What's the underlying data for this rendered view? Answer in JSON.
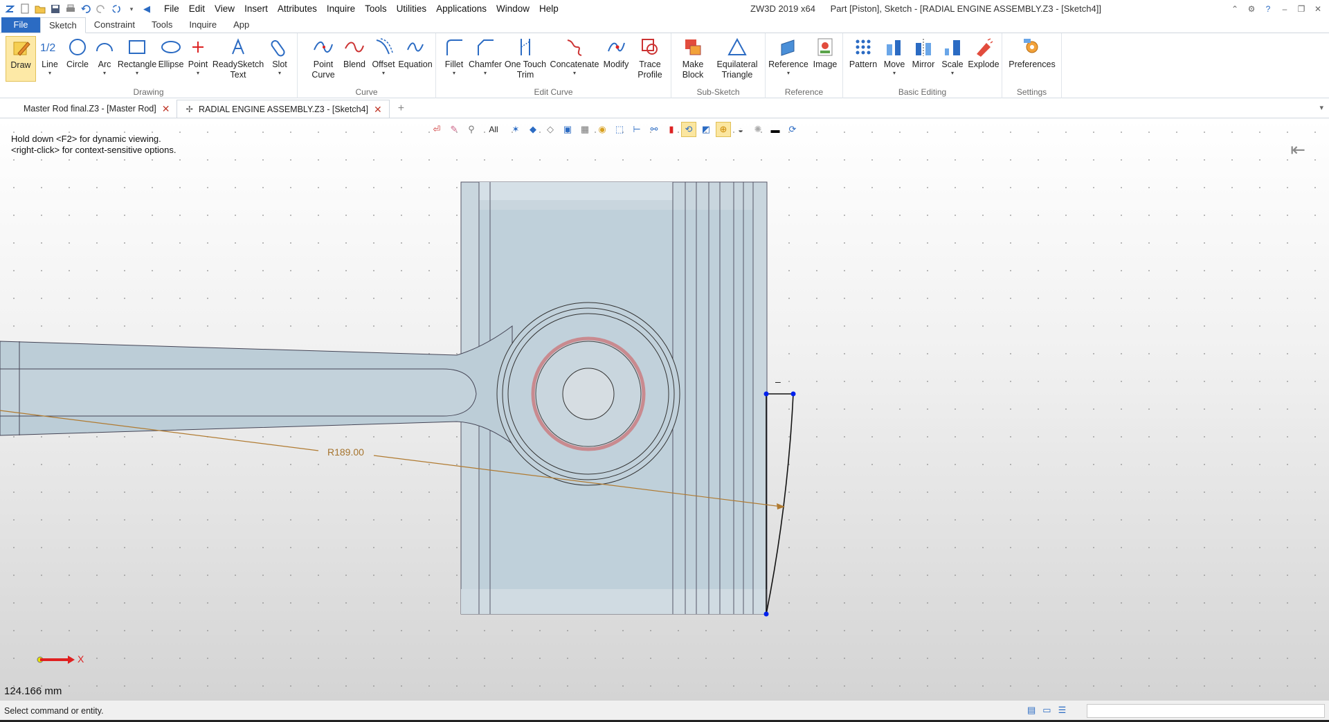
{
  "window": {
    "title": "Part [Piston],  Sketch - [RADIAL ENGINE ASSEMBLY.Z3 - [Sketch4]]",
    "app": "ZW3D 2019  x64"
  },
  "menu": [
    "File",
    "Edit",
    "View",
    "Insert",
    "Attributes",
    "Inquire",
    "Tools",
    "Utilities",
    "Applications",
    "Window",
    "Help"
  ],
  "ribbon_tabs": [
    "File",
    "Sketch",
    "Constraint",
    "Tools",
    "Inquire",
    "App"
  ],
  "groups": {
    "drawing": "Drawing",
    "curve": "Curve",
    "edit_curve": "Edit Curve",
    "sub_sketch": "Sub-Sketch",
    "reference": "Reference",
    "basic_editing": "Basic Editing",
    "settings": "Settings"
  },
  "tools": {
    "draw": "Draw",
    "line": "Line",
    "circle": "Circle",
    "arc": "Arc",
    "rectangle": "Rectangle",
    "ellipse": "Ellipse",
    "point": "Point",
    "readysketch_1": "ReadySketch",
    "readysketch_2": "Text",
    "slot": "Slot",
    "point_curve_1": "Point",
    "point_curve_2": "Curve",
    "blend": "Blend",
    "offset": "Offset",
    "equation": "Equation",
    "fillet": "Fillet",
    "chamfer": "Chamfer",
    "one_touch_1": "One Touch",
    "one_touch_2": "Trim",
    "concatenate": "Concatenate",
    "modify": "Modify",
    "trace_1": "Trace",
    "trace_2": "Profile",
    "make_block_1": "Make",
    "make_block_2": "Block",
    "equilateral_1": "Equilateral",
    "equilateral_2": "Triangle",
    "reference": "Reference",
    "image": "Image",
    "pattern": "Pattern",
    "move": "Move",
    "mirror": "Mirror",
    "scale": "Scale",
    "explode": "Explode",
    "preferences": "Preferences"
  },
  "doc_tabs": [
    {
      "label": "Master Rod final.Z3 - [Master Rod]"
    },
    {
      "label": "RADIAL ENGINE ASSEMBLY.Z3 - [Sketch4]"
    }
  ],
  "viewport": {
    "hint_line1": "Hold down <F2> for dynamic viewing.",
    "hint_line2": "<right-click> for context-sensitive options.",
    "filter": "All",
    "dimension": "R189.00",
    "axis_label": "X",
    "readout": "124.166 mm",
    "minus_sign": "–"
  },
  "status": {
    "text": "Select command or entity."
  },
  "colors": {
    "accent": "#2b6bc3",
    "dimension": "#b07a30",
    "piston_fill": "#c7d5dd",
    "pin_ring": "#c98a8f",
    "sketch_point": "#0022ee"
  }
}
